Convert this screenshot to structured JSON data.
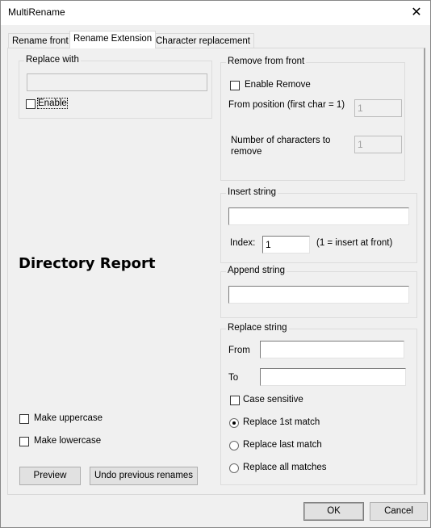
{
  "window": {
    "title": "MultiRename",
    "close_icon": "close-icon"
  },
  "tabs": [
    {
      "label": "Rename front",
      "active": false
    },
    {
      "label": "Rename Extension",
      "active": true
    },
    {
      "label": "Character replacement",
      "active": false
    }
  ],
  "replace_with": {
    "legend": "Replace with",
    "value": "",
    "enable_label": "Enable",
    "enable_checked": false
  },
  "directory_report": "Directory Report",
  "case": {
    "uppercase_label": "Make uppercase",
    "uppercase_checked": false,
    "lowercase_label": "Make lowercase",
    "lowercase_checked": false
  },
  "buttons": {
    "preview": "Preview",
    "undo": "Undo previous renames",
    "ok": "OK",
    "cancel": "Cancel"
  },
  "remove_from_front": {
    "legend": "Remove from front",
    "enable_label": "Enable Remove",
    "enable_checked": false,
    "from_position_label": "From position (first char = 1)",
    "from_position_value": "1",
    "num_chars_label_line1": "Number of characters to",
    "num_chars_label_line2": "remove",
    "num_chars_value": "1"
  },
  "insert_string": {
    "legend": "Insert string",
    "value": "",
    "index_label": "Index:",
    "index_value": "1",
    "index_hint": "(1 = insert at front)"
  },
  "append_string": {
    "legend": "Append string",
    "value": ""
  },
  "replace_string": {
    "legend": "Replace string",
    "from_label": "From",
    "from_value": "",
    "to_label": "To",
    "to_value": "",
    "case_sensitive_label": "Case sensitive",
    "case_sensitive_checked": false,
    "options": [
      {
        "label": "Replace 1st match",
        "selected": true
      },
      {
        "label": "Replace last match",
        "selected": false
      },
      {
        "label": "Replace all matches",
        "selected": false
      }
    ]
  }
}
